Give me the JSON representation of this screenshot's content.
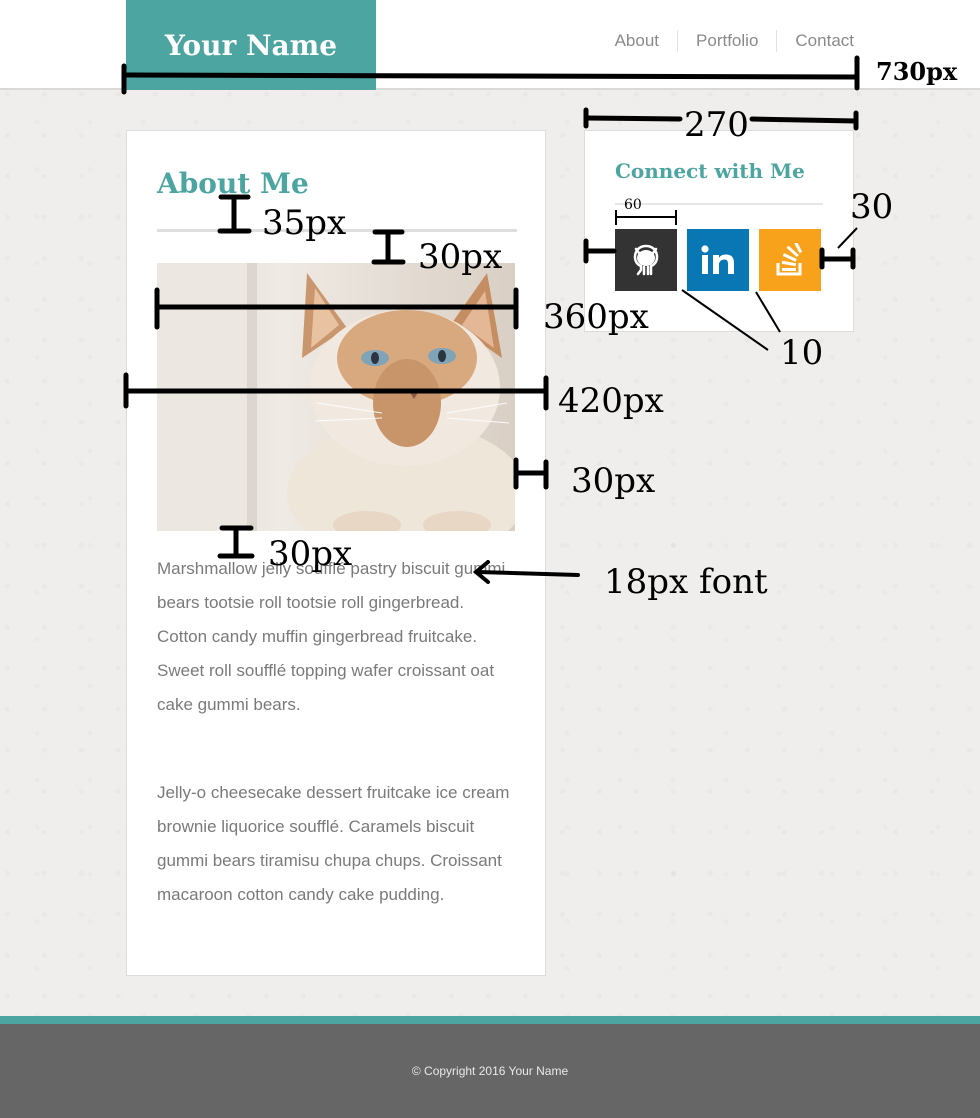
{
  "header": {
    "logo": "Your Name",
    "nav": [
      "About",
      "Portfolio",
      "Contact"
    ]
  },
  "about": {
    "title": "About Me",
    "paragraph1": "Marshmallow jelly soufflé pastry biscuit gummi bears tootsie roll tootsie roll gingerbread. Cotton candy muffin gingerbread fruitcake. Sweet roll soufflé topping wafer croissant oat cake gummi bears.",
    "paragraph2": "Jelly-o cheesecake dessert fruitcake ice cream brownie liquorice soufflé. Caramels biscuit gummi bears tiramisu chupa chups. Croissant macaroon cotton candy cake pudding."
  },
  "connect": {
    "title": "Connect with Me",
    "icons": [
      "github-icon",
      "linkedin-icon",
      "stackoverflow-icon"
    ]
  },
  "footer": {
    "copyright": "© Copyright 2016 Your Name"
  },
  "annotations": {
    "width_730": "730px",
    "width_270": "270",
    "icon_60": "60",
    "pad_30_right": "30",
    "gap_10": "10",
    "title_gap_35": "35px",
    "rule_gap_30": "30px",
    "img_360": "360px",
    "card_420": "420px",
    "pad_30": "30px",
    "text_gap_30": "30px",
    "font_18": "18px font"
  },
  "colors": {
    "accent": "#4ca5a0",
    "footer": "#666666",
    "github": "#333333",
    "linkedin": "#0a77b5",
    "stackoverflow": "#f7a21a"
  }
}
